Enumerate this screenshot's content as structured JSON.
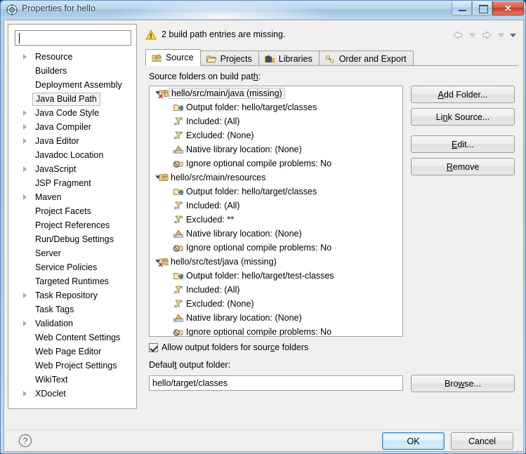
{
  "window": {
    "title": "Properties for hello",
    "icon": "properties-gear-icon",
    "minimize_label": "–",
    "maximize_label": "□",
    "close_label": "✕"
  },
  "sidebar": {
    "filter_placeholder": "",
    "filter_value": "",
    "items": [
      {
        "label": "Resource",
        "expandable": true,
        "selected": false
      },
      {
        "label": "Builders",
        "expandable": false,
        "selected": false
      },
      {
        "label": "Deployment Assembly",
        "expandable": false,
        "selected": false
      },
      {
        "label": "Java Build Path",
        "expandable": false,
        "selected": true
      },
      {
        "label": "Java Code Style",
        "expandable": true,
        "selected": false
      },
      {
        "label": "Java Compiler",
        "expandable": true,
        "selected": false
      },
      {
        "label": "Java Editor",
        "expandable": true,
        "selected": false
      },
      {
        "label": "Javadoc Location",
        "expandable": false,
        "selected": false
      },
      {
        "label": "JavaScript",
        "expandable": true,
        "selected": false
      },
      {
        "label": "JSP Fragment",
        "expandable": false,
        "selected": false
      },
      {
        "label": "Maven",
        "expandable": true,
        "selected": false
      },
      {
        "label": "Project Facets",
        "expandable": false,
        "selected": false
      },
      {
        "label": "Project References",
        "expandable": false,
        "selected": false
      },
      {
        "label": "Run/Debug Settings",
        "expandable": false,
        "selected": false
      },
      {
        "label": "Server",
        "expandable": false,
        "selected": false
      },
      {
        "label": "Service Policies",
        "expandable": false,
        "selected": false
      },
      {
        "label": "Targeted Runtimes",
        "expandable": false,
        "selected": false
      },
      {
        "label": "Task Repository",
        "expandable": true,
        "selected": false
      },
      {
        "label": "Task Tags",
        "expandable": false,
        "selected": false
      },
      {
        "label": "Validation",
        "expandable": true,
        "selected": false
      },
      {
        "label": "Web Content Settings",
        "expandable": false,
        "selected": false
      },
      {
        "label": "Web Page Editor",
        "expandable": false,
        "selected": false
      },
      {
        "label": "Web Project Settings",
        "expandable": false,
        "selected": false
      },
      {
        "label": "WikiText",
        "expandable": false,
        "selected": false
      },
      {
        "label": "XDoclet",
        "expandable": true,
        "selected": false
      }
    ]
  },
  "header": {
    "message": "2 build path entries are missing.",
    "message_icon": "warning-icon",
    "back_icon": "back-arrow-icon",
    "back_menu_icon": "chevron-down-icon",
    "forward_icon": "forward-arrow-icon",
    "forward_menu_icon": "chevron-down-icon",
    "view_menu_icon": "chevron-down-icon"
  },
  "tabs": [
    {
      "label": "Source",
      "icon": "source-folder-icon",
      "active": true
    },
    {
      "label": "Projects",
      "icon": "open-folder-icon",
      "active": false
    },
    {
      "label": "Libraries",
      "icon": "libraries-books-icon",
      "active": false
    },
    {
      "label": "Order and Export",
      "icon": "order-export-icon",
      "active": false
    }
  ],
  "panel": {
    "tree_label": "Source folders on build path:",
    "tree": [
      {
        "label": "hello/src/main/java (missing)",
        "icon": "source-folder-error-icon",
        "selected": true,
        "expanded": true,
        "children": [
          {
            "label": "Output folder: hello/target/classes",
            "icon": "output-folder-icon"
          },
          {
            "label": "Included: (All)",
            "icon": "included-filter-icon"
          },
          {
            "label": "Excluded: (None)",
            "icon": "excluded-filter-icon"
          },
          {
            "label": "Native library location: (None)",
            "icon": "native-library-icon"
          },
          {
            "label": "Ignore optional compile problems: No",
            "icon": "ignore-problems-icon"
          }
        ]
      },
      {
        "label": "hello/src/main/resources",
        "icon": "source-folder-icon",
        "selected": false,
        "expanded": true,
        "children": [
          {
            "label": "Output folder: hello/target/classes",
            "icon": "output-folder-icon"
          },
          {
            "label": "Included: (All)",
            "icon": "included-filter-icon"
          },
          {
            "label": "Excluded: **",
            "icon": "excluded-filter-icon"
          },
          {
            "label": "Native library location: (None)",
            "icon": "native-library-icon"
          },
          {
            "label": "Ignore optional compile problems: No",
            "icon": "ignore-problems-icon"
          }
        ]
      },
      {
        "label": "hello/src/test/java (missing)",
        "icon": "source-folder-error-icon",
        "selected": false,
        "expanded": true,
        "children": [
          {
            "label": "Output folder: hello/target/test-classes",
            "icon": "output-folder-icon"
          },
          {
            "label": "Included: (All)",
            "icon": "included-filter-icon"
          },
          {
            "label": "Excluded: (None)",
            "icon": "excluded-filter-icon"
          },
          {
            "label": "Native library location: (None)",
            "icon": "native-library-icon"
          },
          {
            "label": "Ignore optional compile problems: No",
            "icon": "ignore-problems-icon"
          }
        ]
      }
    ],
    "buttons": [
      {
        "label": "Add Folder...",
        "mnemonic": "A"
      },
      {
        "label": "Link Source...",
        "mnemonic": "n"
      },
      {
        "label": "Edit...",
        "mnemonic": "E"
      },
      {
        "label": "Remove",
        "mnemonic": "R"
      }
    ],
    "allow_output_checkbox": {
      "label": "Allow output folders for source folders",
      "checked": true
    },
    "default_output_label": "Default output folder:",
    "default_output_value": "hello/target/classes",
    "browse_label": "Browse...",
    "browse_mnemonic": "w"
  },
  "footer": {
    "help_icon": "help-question-icon",
    "ok_label": "OK",
    "cancel_label": "Cancel"
  }
}
